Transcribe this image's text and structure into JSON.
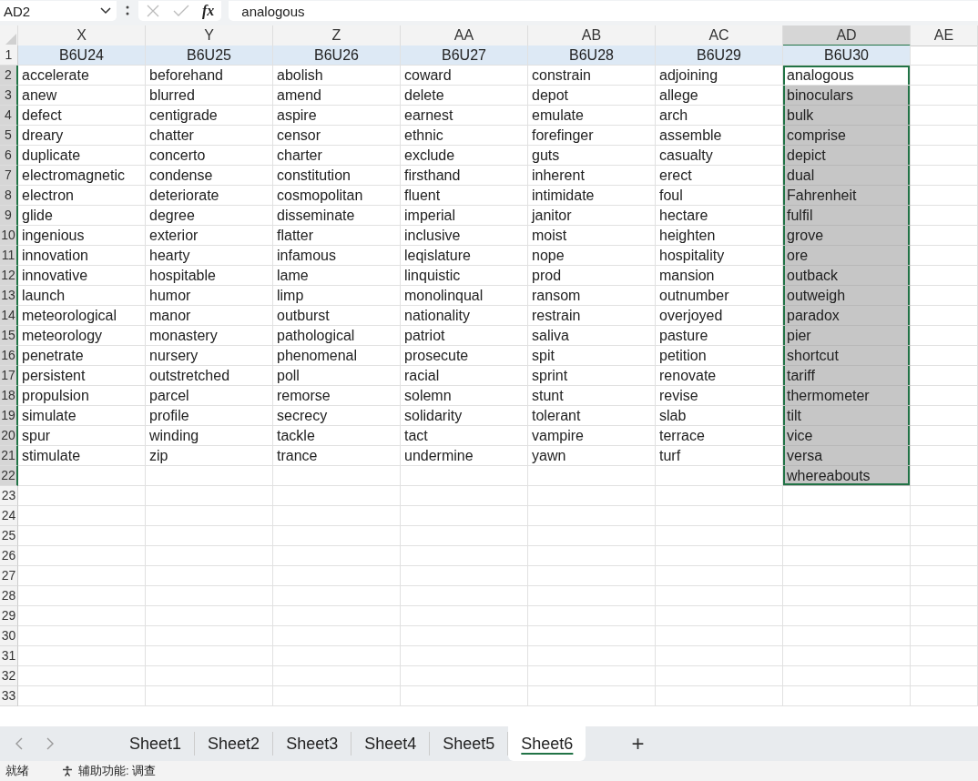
{
  "formula_bar": {
    "name_box": "AD2",
    "function_label": "fx",
    "value": "analogous"
  },
  "columns": [
    {
      "letter": "X",
      "selected": false
    },
    {
      "letter": "Y",
      "selected": false
    },
    {
      "letter": "Z",
      "selected": false
    },
    {
      "letter": "AA",
      "selected": false
    },
    {
      "letter": "AB",
      "selected": false
    },
    {
      "letter": "AC",
      "selected": false
    },
    {
      "letter": "AD",
      "selected": true
    },
    {
      "letter": "AE",
      "selected": false
    }
  ],
  "rows": [
    {
      "number": "1",
      "kind": "header",
      "selected": false,
      "cells": {
        "X": "B6U24",
        "Y": "B6U25",
        "Z": "B6U26",
        "AA": "B6U27",
        "AB": "B6U28",
        "AC": "B6U29",
        "AD": "B6U30"
      }
    },
    {
      "number": "2",
      "kind": "data",
      "selected": true,
      "cells": {
        "X": "accelerate",
        "Y": "beforehand",
        "Z": "abolish",
        "AA": "coward",
        "AB": "constrain",
        "AC": "adjoining",
        "AD": "analogous"
      }
    },
    {
      "number": "3",
      "kind": "data",
      "selected": true,
      "cells": {
        "X": "anew",
        "Y": "blurred",
        "Z": "amend",
        "AA": "delete",
        "AB": "depot",
        "AC": "allege",
        "AD": "binoculars"
      }
    },
    {
      "number": "4",
      "kind": "data",
      "selected": true,
      "cells": {
        "X": "defect",
        "Y": "centigrade",
        "Z": "aspire",
        "AA": "earnest",
        "AB": "emulate",
        "AC": "arch",
        "AD": "bulk"
      }
    },
    {
      "number": "5",
      "kind": "data",
      "selected": true,
      "cells": {
        "X": "dreary",
        "Y": "chatter",
        "Z": "censor",
        "AA": "ethnic",
        "AB": "forefinger",
        "AC": "assemble",
        "AD": "comprise"
      }
    },
    {
      "number": "6",
      "kind": "data",
      "selected": true,
      "cells": {
        "X": "duplicate",
        "Y": "concerto",
        "Z": "charter",
        "AA": "exclude",
        "AB": "guts",
        "AC": "casualty",
        "AD": "depict"
      }
    },
    {
      "number": "7",
      "kind": "data",
      "selected": true,
      "cells": {
        "X": "electromagnetic",
        "Y": "condense",
        "Z": "constitution",
        "AA": "firsthand",
        "AB": "inherent",
        "AC": "erect",
        "AD": "dual"
      }
    },
    {
      "number": "8",
      "kind": "data",
      "selected": true,
      "cells": {
        "X": "electron",
        "Y": "deteriorate",
        "Z": "cosmopolitan",
        "AA": "fluent",
        "AB": "intimidate",
        "AC": "foul",
        "AD": "Fahrenheit"
      }
    },
    {
      "number": "9",
      "kind": "data",
      "selected": true,
      "cells": {
        "X": "glide",
        "Y": "degree",
        "Z": "disseminate",
        "AA": "imperial",
        "AB": "janitor",
        "AC": "hectare",
        "AD": "fulfil"
      }
    },
    {
      "number": "10",
      "kind": "data",
      "selected": true,
      "cells": {
        "X": "ingenious",
        "Y": "exterior",
        "Z": "flatter",
        "AA": "inclusive",
        "AB": "moist",
        "AC": "heighten",
        "AD": "grove"
      }
    },
    {
      "number": "11",
      "kind": "data",
      "selected": true,
      "cells": {
        "X": "innovation",
        "Y": "hearty",
        "Z": "infamous",
        "AA": "leqislature",
        "AB": "nope",
        "AC": "hospitality",
        "AD": "ore"
      }
    },
    {
      "number": "12",
      "kind": "data",
      "selected": true,
      "cells": {
        "X": "innovative",
        "Y": "hospitable",
        "Z": "lame",
        "AA": "linquistic",
        "AB": "prod",
        "AC": "mansion",
        "AD": "outback"
      }
    },
    {
      "number": "13",
      "kind": "data",
      "selected": true,
      "cells": {
        "X": "launch",
        "Y": "humor",
        "Z": "limp",
        "AA": "monolinqual",
        "AB": "ransom",
        "AC": "outnumber",
        "AD": "outweigh"
      }
    },
    {
      "number": "14",
      "kind": "data",
      "selected": true,
      "cells": {
        "X": "meteorological",
        "Y": "manor",
        "Z": "outburst",
        "AA": "nationality",
        "AB": "restrain",
        "AC": "overjoyed",
        "AD": "paradox"
      }
    },
    {
      "number": "15",
      "kind": "data",
      "selected": true,
      "cells": {
        "X": "meteorology",
        "Y": "monastery",
        "Z": "pathological",
        "AA": "patriot",
        "AB": "saliva",
        "AC": "pasture",
        "AD": "pier"
      }
    },
    {
      "number": "16",
      "kind": "data",
      "selected": true,
      "cells": {
        "X": "penetrate",
        "Y": "nursery",
        "Z": "phenomenal",
        "AA": "prosecute",
        "AB": "spit",
        "AC": "petition",
        "AD": "shortcut"
      }
    },
    {
      "number": "17",
      "kind": "data",
      "selected": true,
      "cells": {
        "X": "persistent",
        "Y": "outstretched",
        "Z": "poll",
        "AA": "racial",
        "AB": "sprint",
        "AC": "renovate",
        "AD": "tariff"
      }
    },
    {
      "number": "18",
      "kind": "data",
      "selected": true,
      "cells": {
        "X": "propulsion",
        "Y": "parcel",
        "Z": "remorse",
        "AA": "solemn",
        "AB": "stunt",
        "AC": "revise",
        "AD": "thermometer"
      }
    },
    {
      "number": "19",
      "kind": "data",
      "selected": true,
      "cells": {
        "X": "simulate",
        "Y": "profile",
        "Z": "secrecy",
        "AA": "solidarity",
        "AB": "tolerant",
        "AC": "slab",
        "AD": "tilt"
      }
    },
    {
      "number": "20",
      "kind": "data",
      "selected": true,
      "cells": {
        "X": "spur",
        "Y": "winding",
        "Z": "tackle",
        "AA": "tact",
        "AB": "vampire",
        "AC": "terrace",
        "AD": "vice"
      }
    },
    {
      "number": "21",
      "kind": "data",
      "selected": true,
      "cells": {
        "X": "stimulate",
        "Y": "zip",
        "Z": "trance",
        "AA": "undermine",
        "AB": "yawn",
        "AC": "turf",
        "AD": "versa"
      }
    },
    {
      "number": "22",
      "kind": "data",
      "selected": true,
      "cells": {
        "AD": "whereabouts"
      }
    },
    {
      "number": "23",
      "kind": "data",
      "selected": false
    },
    {
      "number": "24",
      "kind": "data",
      "selected": false
    },
    {
      "number": "25",
      "kind": "data",
      "selected": false
    },
    {
      "number": "26",
      "kind": "data",
      "selected": false
    },
    {
      "number": "27",
      "kind": "data",
      "selected": false
    },
    {
      "number": "28",
      "kind": "data",
      "selected": false
    },
    {
      "number": "29",
      "kind": "data",
      "selected": false
    },
    {
      "number": "30",
      "kind": "data",
      "selected": false
    },
    {
      "number": "31",
      "kind": "data",
      "selected": false
    },
    {
      "number": "32",
      "kind": "data",
      "selected": false
    },
    {
      "number": "33",
      "kind": "data",
      "selected": false
    }
  ],
  "sheet_tabs": [
    {
      "label": "Sheet1",
      "selected": false
    },
    {
      "label": "Sheet2",
      "selected": false
    },
    {
      "label": "Sheet3",
      "selected": false
    },
    {
      "label": "Sheet4",
      "selected": false
    },
    {
      "label": "Sheet5",
      "selected": false
    },
    {
      "label": "Sheet6",
      "selected": true
    }
  ],
  "add_sheet": "+",
  "status_bar": {
    "state": "就绪",
    "accessibility": "辅助功能: 调查"
  }
}
